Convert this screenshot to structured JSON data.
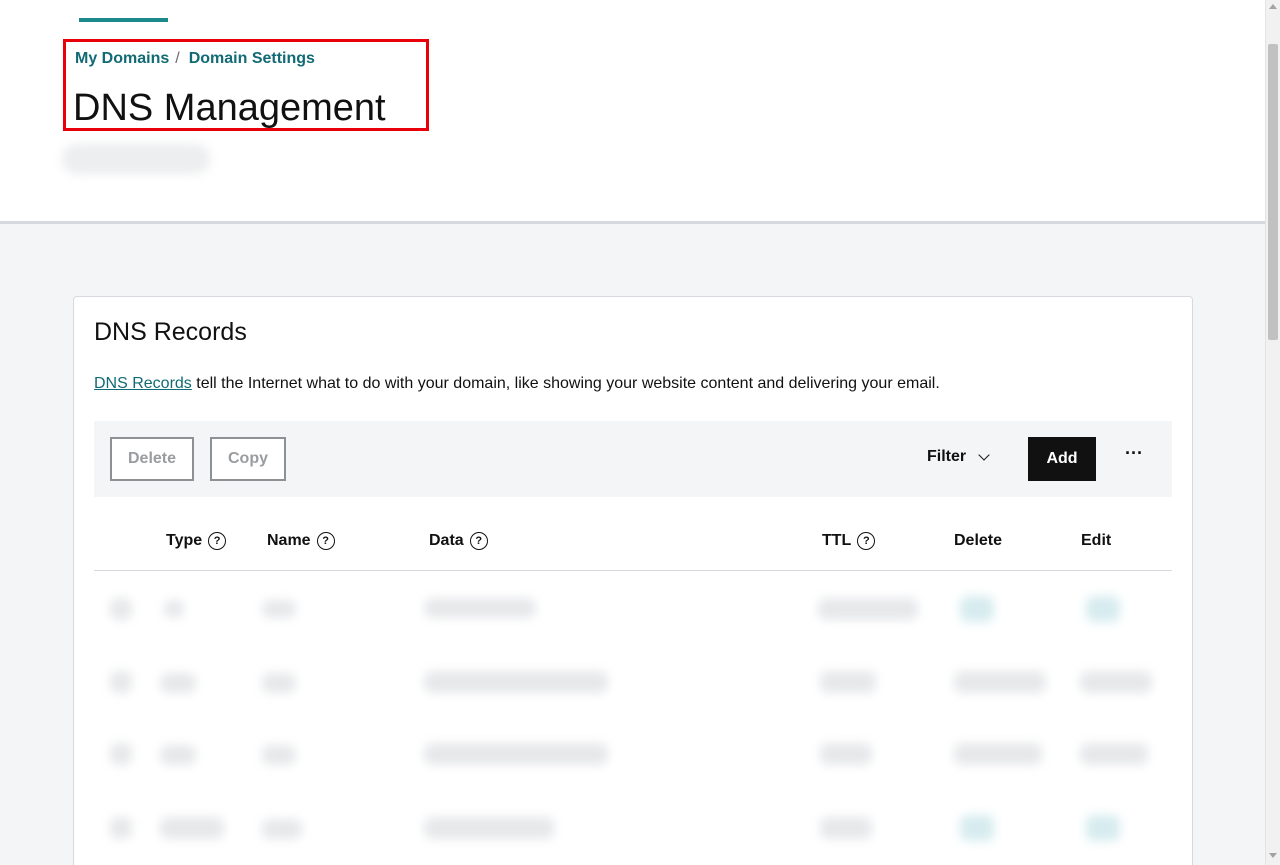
{
  "breadcrumb": {
    "item1": "My Domains",
    "separator": "/",
    "item2": "Domain Settings"
  },
  "page_title": "DNS Management",
  "card": {
    "title": "DNS Records",
    "desc_link": "DNS Records",
    "desc_text": " tell the Internet what to do with your domain, like showing your website content and delivering your email."
  },
  "toolbar": {
    "delete_label": "Delete",
    "copy_label": "Copy",
    "filter_label": "Filter",
    "add_label": "Add",
    "more_label": "···"
  },
  "table": {
    "col_type": "Type",
    "col_name": "Name",
    "col_data": "Data",
    "col_ttl": "TTL",
    "col_delete": "Delete",
    "col_edit": "Edit",
    "help_glyph": "?"
  },
  "colors": {
    "accent": "#1c8a8a",
    "link": "#116a74",
    "highlight": "#e8000b",
    "primary_button": "#111111"
  }
}
